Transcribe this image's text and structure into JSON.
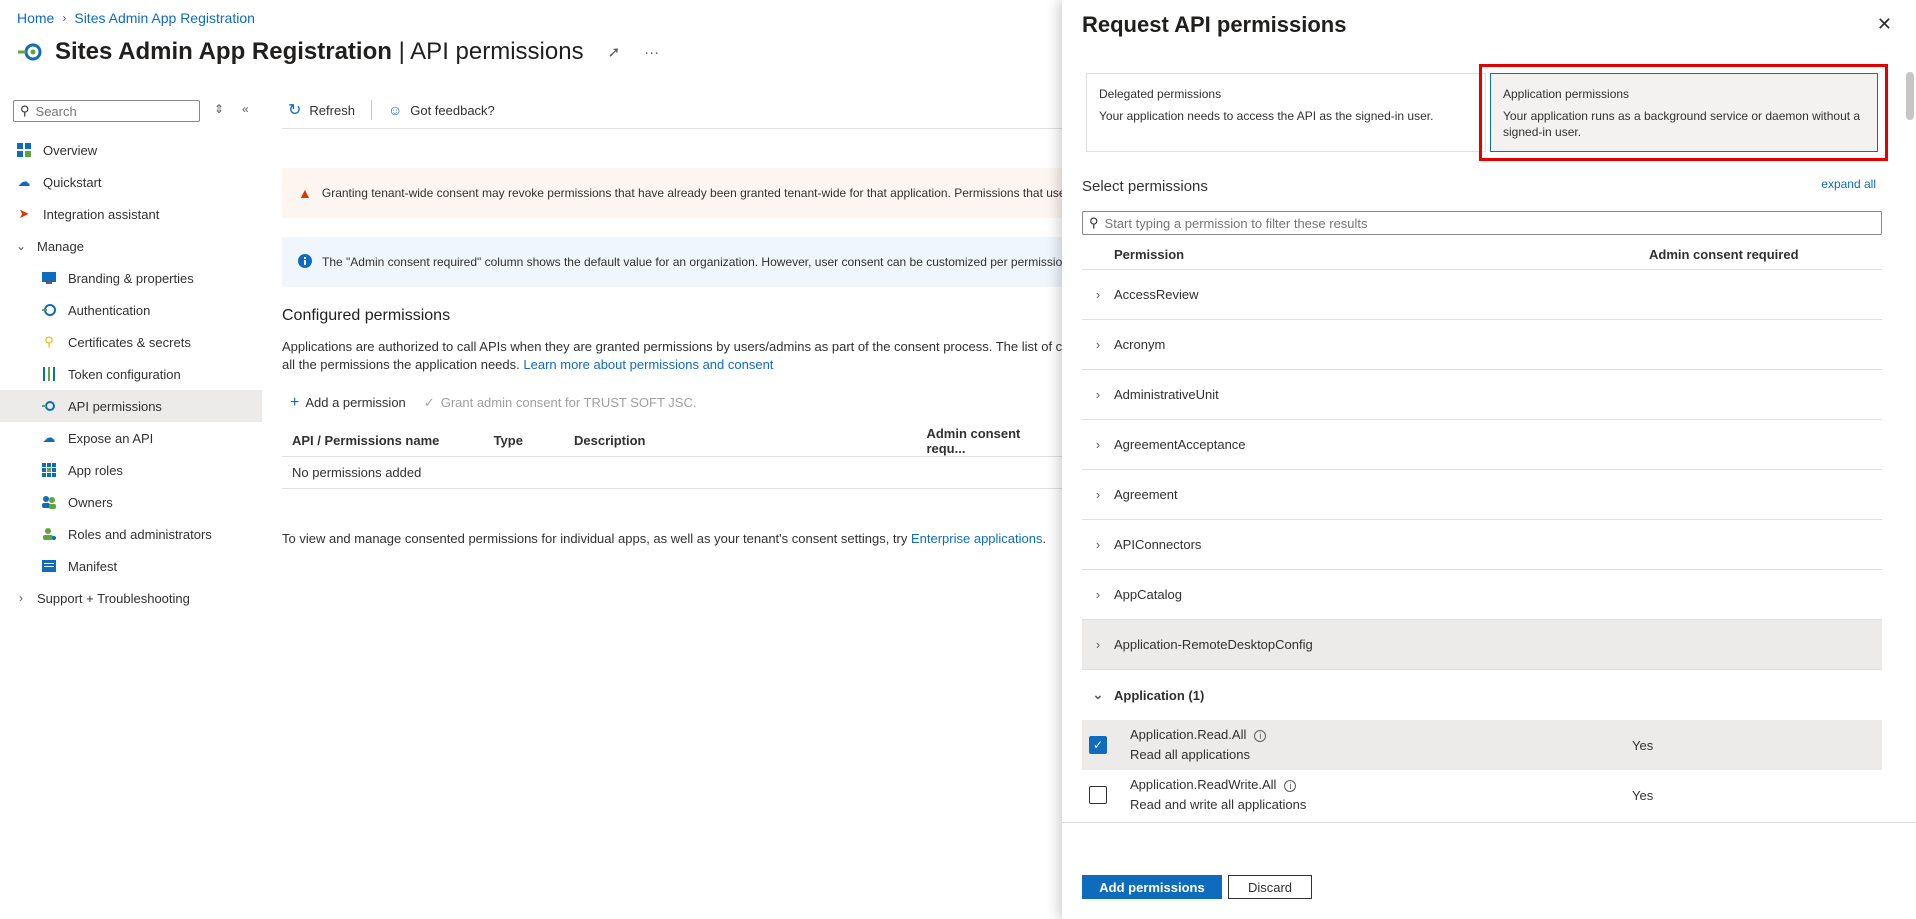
{
  "breadcrumb": {
    "home": "Home",
    "current": "Sites Admin App Registration"
  },
  "header": {
    "title_main": "Sites Admin App Registration",
    "title_sep": " | ",
    "title_sub": "API permissions"
  },
  "sidebar": {
    "search_placeholder": "Search",
    "items": [
      {
        "label": "Overview",
        "icon": "overview-icon"
      },
      {
        "label": "Quickstart",
        "icon": "cloud-icon"
      },
      {
        "label": "Integration assistant",
        "icon": "rocket-icon"
      },
      {
        "label": "Manage",
        "icon": "chevron-down-icon"
      },
      {
        "label": "Branding & properties",
        "icon": "branding-icon"
      },
      {
        "label": "Authentication",
        "icon": "authentication-icon"
      },
      {
        "label": "Certificates & secrets",
        "icon": "key-icon"
      },
      {
        "label": "Token configuration",
        "icon": "token-icon"
      },
      {
        "label": "API permissions",
        "icon": "api-icon"
      },
      {
        "label": "Expose an API",
        "icon": "cloud-icon"
      },
      {
        "label": "App roles",
        "icon": "grid-icon"
      },
      {
        "label": "Owners",
        "icon": "owners-icon"
      },
      {
        "label": "Roles and administrators",
        "icon": "roles-icon"
      },
      {
        "label": "Manifest",
        "icon": "manifest-icon"
      },
      {
        "label": "Support + Troubleshooting",
        "icon": "chevron-right-icon"
      }
    ]
  },
  "toolbar": {
    "refresh": "Refresh",
    "feedback": "Got feedback?"
  },
  "banners": {
    "warning": "Granting tenant-wide consent may revoke permissions that have already been granted tenant-wide for that application. Permissions that use",
    "info": "The \"Admin consent required\" column shows the default value for an organization. However, user consent can be customized per permission"
  },
  "configured": {
    "title": "Configured permissions",
    "desc_line1": "Applications are authorized to call APIs when they are granted permissions by users/admins as part of the consent process. The list of co",
    "desc_line2": "all the permissions the application needs. ",
    "learn_more": "Learn more about permissions and consent",
    "add_permission": "Add a permission",
    "grant_consent": "Grant admin consent for TRUST SOFT JSC.",
    "columns": [
      "API / Permissions name",
      "Type",
      "Description",
      "Admin consent requ..."
    ],
    "empty": "No permissions added",
    "footer_text": "To view and manage consented permissions for individual apps, as well as your tenant's consent settings, try ",
    "footer_link": "Enterprise applications",
    "footer_end": "."
  },
  "panel": {
    "title": "Request API permissions",
    "delegated": {
      "title": "Delegated permissions",
      "desc": "Your application needs to access the API as the signed-in user."
    },
    "application": {
      "title": "Application permissions",
      "desc": "Your application runs as a background service or daemon without a signed-in user."
    },
    "select_title": "Select permissions",
    "expand_all": "expand all",
    "filter_placeholder": "Start typing a permission to filter these results",
    "col_permission": "Permission",
    "col_admin": "Admin consent required",
    "groups": [
      "AccessReview",
      "Acronym",
      "AdministrativeUnit",
      "AgreementAcceptance",
      "Agreement",
      "APIConnectors",
      "AppCatalog",
      "Application-RemoteDesktopConfig"
    ],
    "open_group": "Application (1)",
    "perms": [
      {
        "name": "Application.Read.All",
        "desc": "Read all applications",
        "admin": "Yes",
        "checked": true
      },
      {
        "name": "Application.ReadWrite.All",
        "desc": "Read and write all applications",
        "admin": "Yes",
        "checked": false
      }
    ],
    "add_button": "Add permissions",
    "discard_button": "Discard"
  },
  "colors": {
    "accent": "#0f6cbd",
    "highlight": "#e50000",
    "warning_icon": "#d83b01"
  }
}
